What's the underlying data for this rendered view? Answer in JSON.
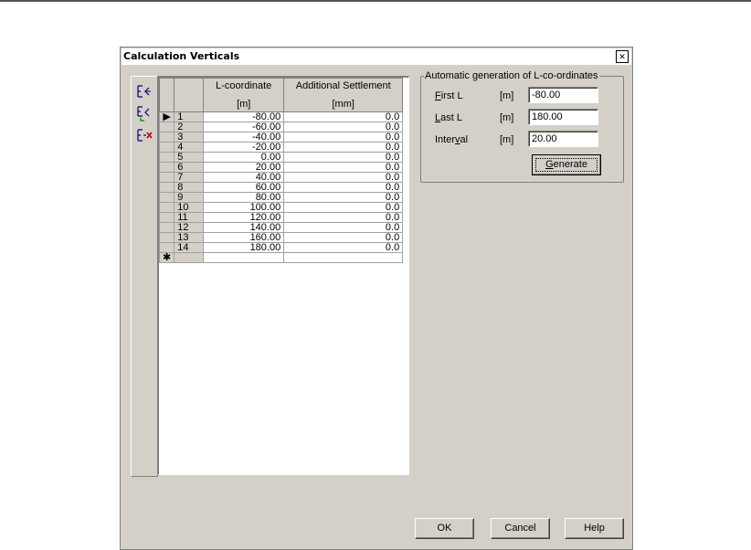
{
  "dialog": {
    "title": "Calculation Verticals",
    "close_glyph": "✕"
  },
  "toolbar": {
    "buttons": [
      {
        "icon": "insert-row-icon"
      },
      {
        "icon": "add-row-icon"
      },
      {
        "icon": "delete-row-icon"
      }
    ]
  },
  "grid": {
    "columns": [
      {
        "title": "L-coordinate",
        "unit": "[m]"
      },
      {
        "title": "Additional Settlement",
        "unit": "[mm]"
      }
    ],
    "rows": [
      {
        "n": "1",
        "l": "-80.00",
        "s": "0.0"
      },
      {
        "n": "2",
        "l": "-60.00",
        "s": "0.0"
      },
      {
        "n": "3",
        "l": "-40.00",
        "s": "0.0"
      },
      {
        "n": "4",
        "l": "-20.00",
        "s": "0.0"
      },
      {
        "n": "5",
        "l": "0.00",
        "s": "0.0"
      },
      {
        "n": "6",
        "l": "20.00",
        "s": "0.0"
      },
      {
        "n": "7",
        "l": "40.00",
        "s": "0.0"
      },
      {
        "n": "8",
        "l": "60.00",
        "s": "0.0"
      },
      {
        "n": "9",
        "l": "80.00",
        "s": "0.0"
      },
      {
        "n": "10",
        "l": "100.00",
        "s": "0.0"
      },
      {
        "n": "11",
        "l": "120.00",
        "s": "0.0"
      },
      {
        "n": "12",
        "l": "140.00",
        "s": "0.0"
      },
      {
        "n": "13",
        "l": "160.00",
        "s": "0.0"
      },
      {
        "n": "14",
        "l": "180.00",
        "s": "0.0"
      }
    ],
    "current_row_marker": "▶",
    "new_row_marker": "✱"
  },
  "autogen": {
    "legend": "Automatic generation of L-co-ordinates",
    "first": {
      "label_accel": "F",
      "label_rest": "irst L",
      "unit": "[m]",
      "value": "-80.00"
    },
    "last": {
      "label_accel": "L",
      "label_rest": "ast L",
      "unit": "[m]",
      "value": "180.00"
    },
    "interval": {
      "label_pre": "Inter",
      "label_accel": "v",
      "label_rest": "al",
      "unit": "[m]",
      "value": "20.00"
    },
    "generate": {
      "accel": "G",
      "rest": "enerate"
    }
  },
  "footer": {
    "ok": "OK",
    "cancel": "Cancel",
    "help": "Help"
  }
}
